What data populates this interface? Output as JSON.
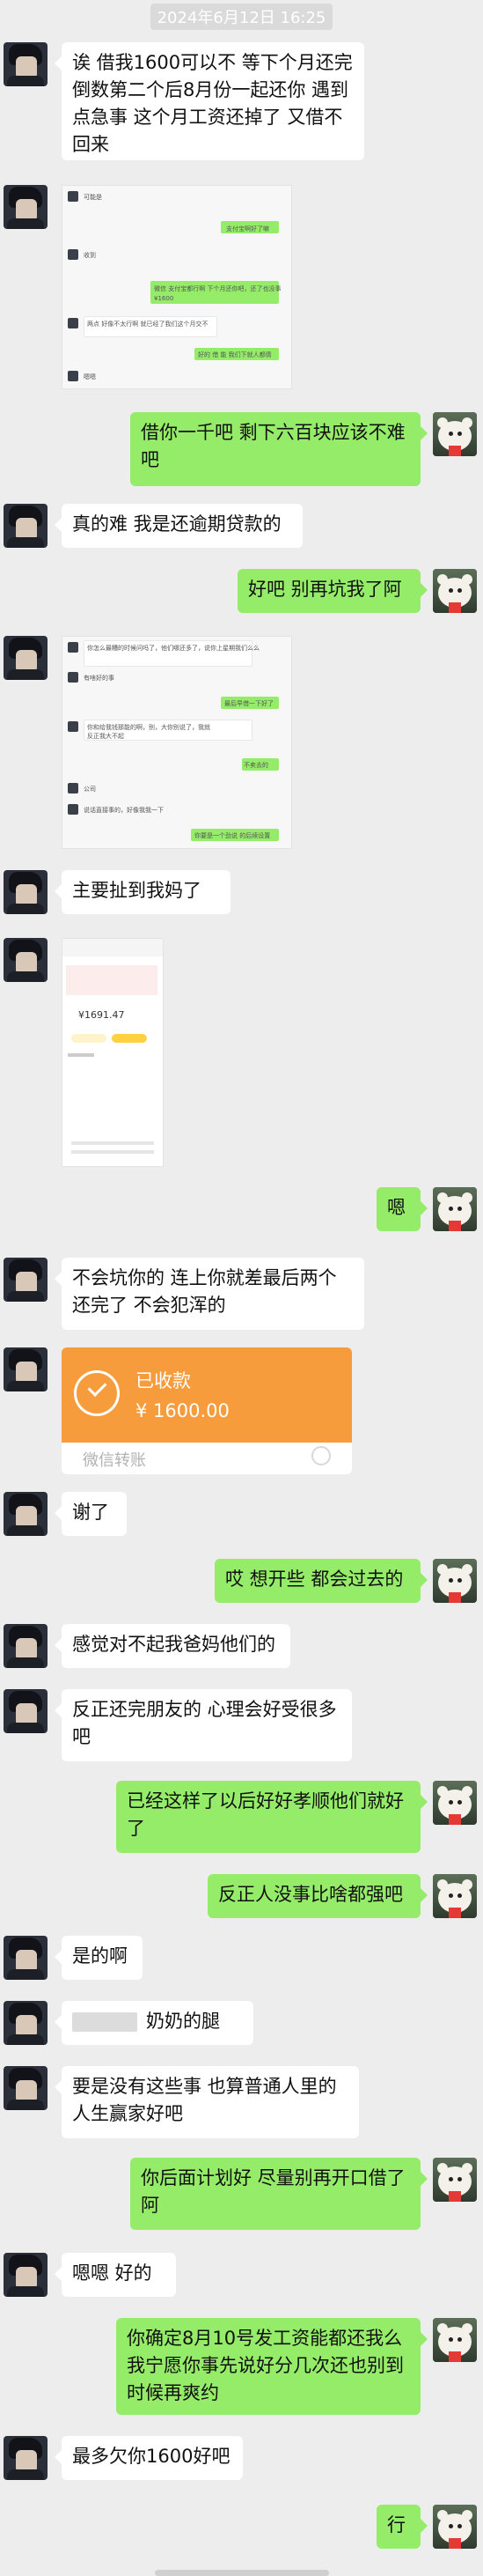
{
  "timestamp": "2024年6月12日 16:25",
  "messages": [
    {
      "side": "left",
      "text": "诶   借我1600可以不 等下个月还完倒数第二个后8月份一起还你 遇到点急事   这个月工资还掉了 又借不回来"
    },
    {
      "side": "left",
      "type": "screenshot",
      "description_texts": [
        "可能是",
        "支付宝啊好了嘛",
        "收到",
        "微信 支付宝都行啊 下个月还你吧，还了也没事",
        "¥1600",
        "两点 好像不太行啊 就已经了我们这个月交不",
        "好的 借 能 我们下就人都倩",
        "嗯嗯"
      ]
    },
    {
      "side": "right",
      "text": "借你一千吧 剩下六百块应该不难吧"
    },
    {
      "side": "left",
      "text": "真的难   我是还逾期贷款的"
    },
    {
      "side": "right",
      "text": "好吧 别再坑我了阿"
    },
    {
      "side": "left",
      "type": "screenshot",
      "description_texts": [
        "你怎么最糟的时候问吗了，他们哪还多了，说你上星期我们么么",
        "有啥好的事",
        "最后早借一下好了",
        "你和给我钱那能的啊，别，大你别说了，我就",
        "反正我大不起",
        "不卖去的",
        "公司",
        "说话直接事的，好像我我一下",
        "你要是一个劲说 的后续设置"
      ]
    },
    {
      "side": "left",
      "text": "主要扯到我妈了"
    },
    {
      "side": "left",
      "type": "phone-screenshot",
      "amount": "¥1691.47"
    },
    {
      "side": "right",
      "text": "嗯"
    },
    {
      "side": "left",
      "text": "不会坑你的   连上你就差最后两个还完了   不会犯浑的"
    },
    {
      "side": "left",
      "type": "transfer",
      "status": "已收款",
      "amount": "¥ 1600.00",
      "footer": "微信转账"
    },
    {
      "side": "left",
      "text": "谢了"
    },
    {
      "side": "right",
      "text": "哎 想开些 都会过去的"
    },
    {
      "side": "left",
      "text": "感觉对不起我爸妈他们的"
    },
    {
      "side": "left",
      "text": "反正还完朋友的 心理会好受很多吧"
    },
    {
      "side": "right",
      "text": "已经这样了以后好好孝顺他们就好了"
    },
    {
      "side": "right",
      "text": "反正人没事比啥都强吧"
    },
    {
      "side": "left",
      "text": "是的啊"
    },
    {
      "side": "left",
      "text": "奶奶的腿"
    },
    {
      "side": "left",
      "text": "要是没有这些事  也算普通人里的人生赢家好吧"
    },
    {
      "side": "right",
      "text": "你后面计划好 尽量别再开口借了阿"
    },
    {
      "side": "left",
      "text": "嗯嗯   好的"
    },
    {
      "side": "right",
      "text": "你确定8月10号发工资能都还我么 我宁愿你事先说好分几次还也别到时候再爽约"
    },
    {
      "side": "left",
      "text": "最多欠你1600好吧"
    },
    {
      "side": "right",
      "text": "行"
    }
  ],
  "colors": {
    "background": "#ededed",
    "self_bubble": "#95ec69",
    "other_bubble": "#ffffff",
    "transfer": "#f79c3c"
  },
  "icons": {
    "transfer": "check-circle-icon",
    "avatar_left": "dark-hair-person-avatar",
    "avatar_right": "white-bear-avatar"
  }
}
